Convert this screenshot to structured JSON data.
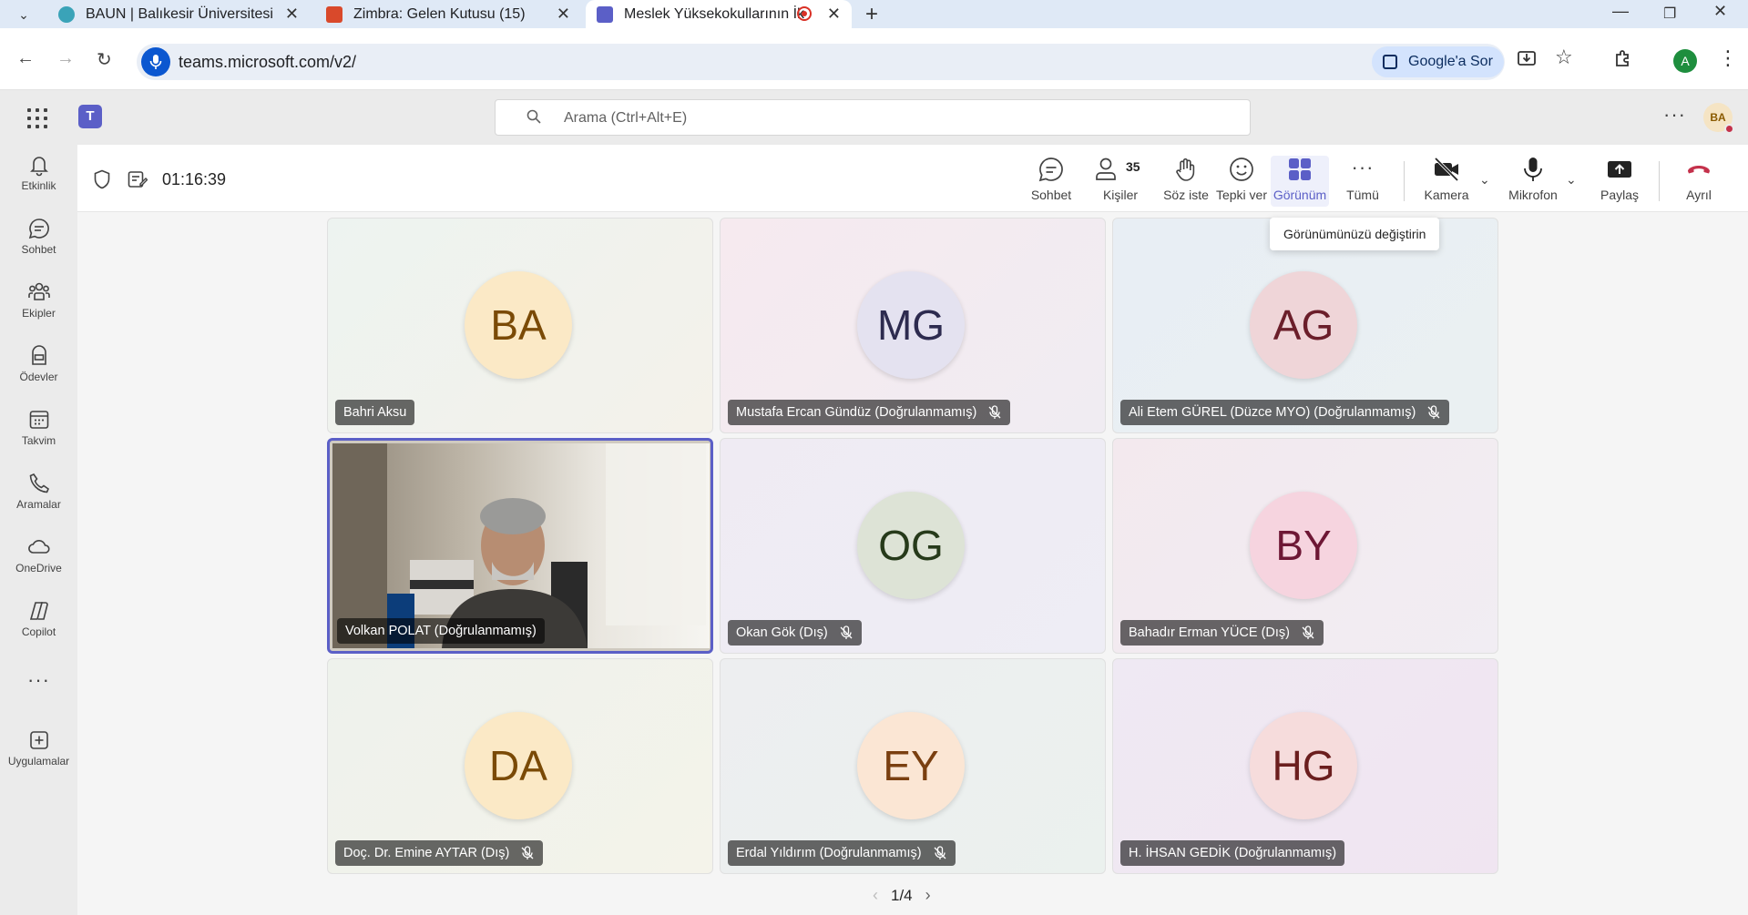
{
  "browser": {
    "tabs": [
      {
        "title": "BAUN | Balıkesir Üniversitesi"
      },
      {
        "title": "Zimbra: Gelen Kutusu (15)"
      },
      {
        "title": "Meslek Yüksekokullarının İk"
      }
    ],
    "url": "teams.microsoft.com/v2/",
    "google_button": "Google'a Sor",
    "profile_initial": "A"
  },
  "app": {
    "search_placeholder": "Arama (Ctrl+Alt+E)",
    "user_initials": "BA"
  },
  "rail": [
    {
      "label": "Etkinlik",
      "icon": "bell-icon"
    },
    {
      "label": "Sohbet",
      "icon": "chat-icon"
    },
    {
      "label": "Ekipler",
      "icon": "teams-icon"
    },
    {
      "label": "Ödevler",
      "icon": "assignments-icon"
    },
    {
      "label": "Takvim",
      "icon": "calendar-icon"
    },
    {
      "label": "Aramalar",
      "icon": "phone-icon"
    },
    {
      "label": "OneDrive",
      "icon": "cloud-icon"
    },
    {
      "label": "Copilot",
      "icon": "copilot-icon"
    },
    {
      "label": "Uygulamalar",
      "icon": "add-apps-icon"
    }
  ],
  "meeting": {
    "elapsed": "01:16:39",
    "participant_count": "35",
    "controls": {
      "chat": "Sohbet",
      "people": "Kişiler",
      "raise_hand": "Söz iste",
      "react": "Tepki ver",
      "view": "Görünüm",
      "more": "Tümü",
      "camera": "Kamera",
      "mic": "Mikrofon",
      "share": "Paylaş",
      "leave": "Ayrıl"
    },
    "tooltip": "Görünümünüzü değiştirin",
    "pager": "1/4",
    "accent": "#5b5fc7"
  },
  "tiles": [
    {
      "initials": "BA",
      "name": "Bahri Aksu",
      "muted": false
    },
    {
      "initials": "MG",
      "name": "Mustafa Ercan Gündüz (Doğrulanmamış)",
      "muted": true
    },
    {
      "initials": "AG",
      "name": "Ali Etem GÜREL (Düzce MYO) (Doğrulanmamış)",
      "muted": true
    },
    {
      "initials": "",
      "name": "Volkan POLAT (Doğrulanmamış)",
      "muted": false,
      "video": true
    },
    {
      "initials": "OG",
      "name": "Okan Gök (Dış)",
      "muted": true
    },
    {
      "initials": "BY",
      "name": "Bahadır Erman YÜCE (Dış)",
      "muted": true
    },
    {
      "initials": "DA",
      "name": "Doç. Dr. Emine AYTAR (Dış)",
      "muted": true
    },
    {
      "initials": "EY",
      "name": "Erdal Yıldırım (Doğrulanmamış)",
      "muted": true
    },
    {
      "initials": "HG",
      "name": "H. İHSAN GEDİK (Doğrulanmamış)",
      "muted": false
    }
  ]
}
